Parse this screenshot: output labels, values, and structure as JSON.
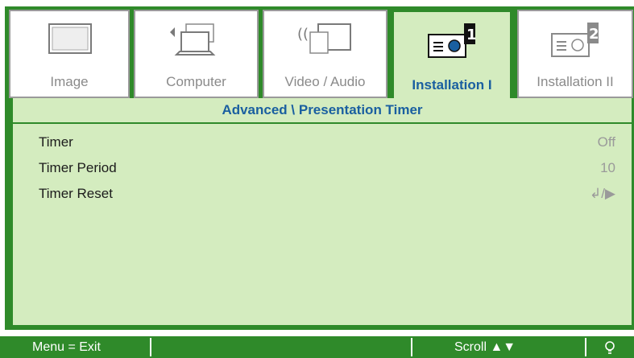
{
  "tabs": [
    {
      "label": "Image",
      "icon": "monitor-icon",
      "active": false
    },
    {
      "label": "Computer",
      "icon": "laptop-icon",
      "active": false
    },
    {
      "label": "Video / Audio",
      "icon": "wireless-screen-icon",
      "active": false
    },
    {
      "label": "Installation I",
      "icon": "projector-1-icon",
      "active": true
    },
    {
      "label": "Installation II",
      "icon": "projector-2-icon",
      "active": false
    }
  ],
  "panel": {
    "title": "Advanced \\ Presentation Timer",
    "rows": [
      {
        "name": "Timer",
        "value": "Off"
      },
      {
        "name": "Timer Period",
        "value": "10"
      },
      {
        "name": "Timer Reset",
        "value": "↲/▶"
      }
    ]
  },
  "footer": {
    "menu": "Menu = Exit",
    "scroll": "Scroll ▲▼",
    "icon": "lamp-icon"
  },
  "colors": {
    "frame_green": "#2f8a2a",
    "panel_bg": "#d4ecbf",
    "title_blue": "#1a5fa0",
    "inactive_gray": "#9a9a9a"
  }
}
